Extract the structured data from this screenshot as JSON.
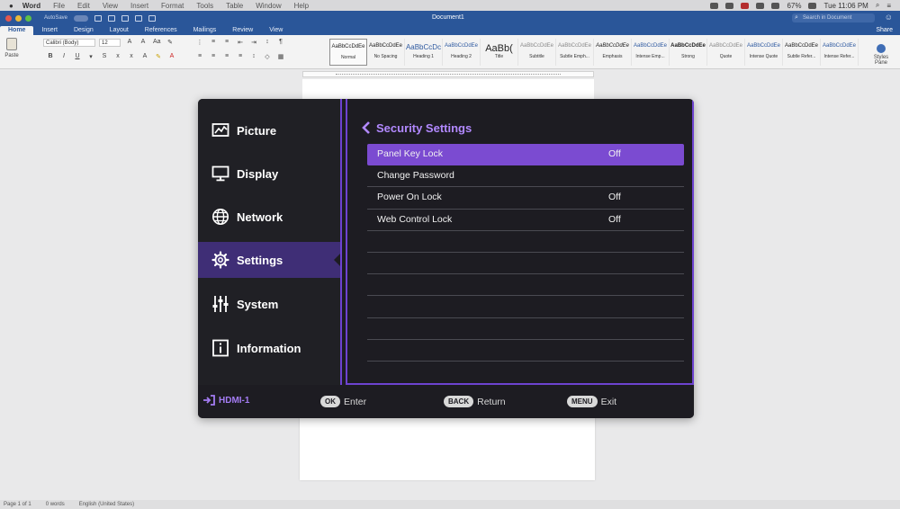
{
  "menubar": {
    "app": "Word",
    "items": [
      "File",
      "Edit",
      "View",
      "Insert",
      "Format",
      "Tools",
      "Table",
      "Window",
      "Help"
    ],
    "battery": "67%",
    "clock": "Tue 11:06 PM"
  },
  "word": {
    "autosave": "AutoSave",
    "doc_title": "Document1",
    "search_placeholder": "Search in Document",
    "tabs": [
      "Home",
      "Insert",
      "Design",
      "Layout",
      "References",
      "Mailings",
      "Review",
      "View"
    ],
    "share": "Share",
    "paste": "Paste",
    "font_name": "Calibri (Body)",
    "font_size": "12",
    "styles": [
      {
        "sample": "AaBbCcDdEe",
        "name": "Normal"
      },
      {
        "sample": "AaBbCcDdEe",
        "name": "No Spacing"
      },
      {
        "sample": "AaBbCcDc",
        "name": "Heading 1"
      },
      {
        "sample": "AaBbCcDdEe",
        "name": "Heading 2"
      },
      {
        "sample": "AaBb(",
        "name": "Title"
      },
      {
        "sample": "AaBbCcDdEe",
        "name": "Subtitle"
      },
      {
        "sample": "AaBbCcDdEe",
        "name": "Subtle Emph..."
      },
      {
        "sample": "AaBbCcDdEe",
        "name": "Emphasis"
      },
      {
        "sample": "AaBbCcDdEe",
        "name": "Intense Emp..."
      },
      {
        "sample": "AaBbCcDdEe",
        "name": "Strong"
      },
      {
        "sample": "AaBbCcDdEe",
        "name": "Quote"
      },
      {
        "sample": "AaBbCcDdEe",
        "name": "Intense Quote"
      },
      {
        "sample": "AaBbCcDdEe",
        "name": "Subtle Refer..."
      },
      {
        "sample": "AaBbCcDdEe",
        "name": "Intense Refer..."
      }
    ],
    "styles_pane": "Styles Pane",
    "status": {
      "page": "Page 1 of 1",
      "words": "0 words",
      "language": "English (United States)"
    }
  },
  "osd": {
    "menu": [
      {
        "id": "picture",
        "label": "Picture",
        "icon": "picture-icon"
      },
      {
        "id": "display",
        "label": "Display",
        "icon": "display-icon"
      },
      {
        "id": "network",
        "label": "Network",
        "icon": "globe-icon"
      },
      {
        "id": "settings",
        "label": "Settings",
        "icon": "gear-icon"
      },
      {
        "id": "system",
        "label": "System",
        "icon": "sliders-icon"
      },
      {
        "id": "information",
        "label": "Information",
        "icon": "info-icon"
      }
    ],
    "active_menu": "Settings",
    "section_title": "Security Settings",
    "rows": [
      {
        "label": "Panel Key Lock",
        "value": "Off"
      },
      {
        "label": "Change Password",
        "value": ""
      },
      {
        "label": "Power On Lock",
        "value": "Off"
      },
      {
        "label": "Web Control Lock",
        "value": "Off"
      },
      {
        "label": "",
        "value": ""
      },
      {
        "label": "",
        "value": ""
      },
      {
        "label": "",
        "value": ""
      },
      {
        "label": "",
        "value": ""
      },
      {
        "label": "",
        "value": ""
      },
      {
        "label": "",
        "value": ""
      }
    ],
    "selected_row": "Panel Key Lock",
    "footer": {
      "source": "HDMI-1",
      "ok_key": "OK",
      "ok_label": "Enter",
      "back_key": "BACK",
      "back_label": "Return",
      "menu_key": "MENU",
      "menu_label": "Exit"
    },
    "colors": {
      "accent": "#7b4bd1",
      "title": "#b289ff",
      "panel": "#1d1c22",
      "active_tab": "#3f2e76"
    }
  }
}
